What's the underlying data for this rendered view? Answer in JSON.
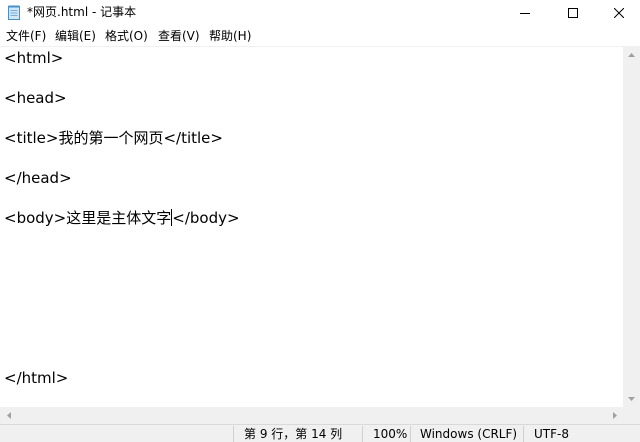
{
  "window": {
    "title": "*网页.html - 记事本",
    "icon": "notepad-icon"
  },
  "menu": [
    {
      "label": "文件(F)"
    },
    {
      "label": "编辑(E)"
    },
    {
      "label": "格式(O)"
    },
    {
      "label": "查看(V)"
    },
    {
      "label": "帮助(H)"
    }
  ],
  "editor": {
    "lines": [
      "<html>",
      "",
      "<head>",
      "",
      "<title>我的第一个网页</title>",
      "",
      "</head>",
      "",
      "<body>这里是主体文字</body>",
      "",
      "",
      "",
      "",
      "",
      "",
      "",
      "</html>"
    ],
    "caret_line_before": "<body>这里是主体文字",
    "caret_line_after": "</body>"
  },
  "status": {
    "position": "第 9 行，第 14 列",
    "zoom": "100%",
    "line_ending": "Windows (CRLF)",
    "encoding": "UTF-8"
  }
}
